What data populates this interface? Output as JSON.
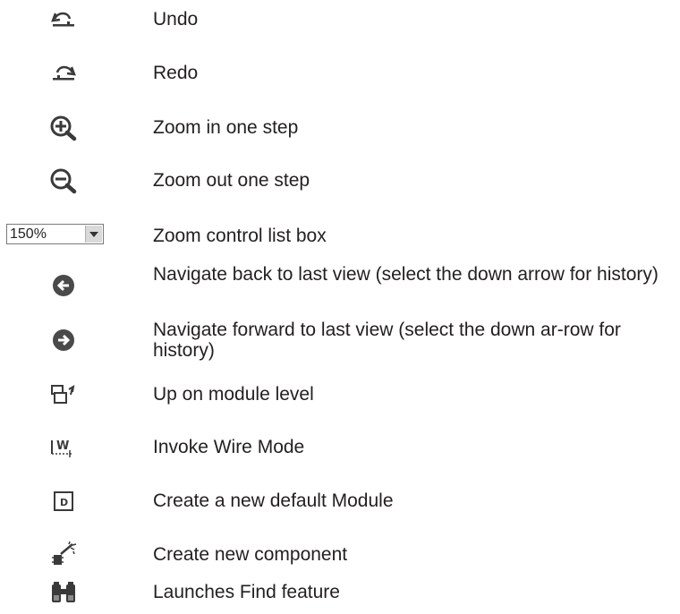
{
  "items": [
    {
      "icon": "undo-icon",
      "label": "Undo"
    },
    {
      "icon": "redo-icon",
      "label": "Redo"
    },
    {
      "icon": "zoom-in-icon",
      "label": "Zoom in one step"
    },
    {
      "icon": "zoom-out-icon",
      "label": "Zoom out one step"
    },
    {
      "icon": "zoom-list-box",
      "label": "Zoom control list box",
      "zoom_value": "150%"
    },
    {
      "icon": "navigate-back-icon",
      "label": "Navigate back to last view (select the down arrow for history)"
    },
    {
      "icon": "navigate-forward-icon",
      "label": "Navigate forward to last view (select the down ar-row for history)"
    },
    {
      "icon": "module-up-icon",
      "label": "Up on module level"
    },
    {
      "icon": "wire-mode-icon",
      "label": "Invoke Wire Mode"
    },
    {
      "icon": "default-module-icon",
      "label": "Create a new default Module"
    },
    {
      "icon": "new-component-icon",
      "label": "Create new component"
    },
    {
      "icon": "binoculars-icon",
      "label": "Launches Find feature"
    }
  ],
  "colors": {
    "text": "#231f20",
    "icon": "#3a3a3a"
  }
}
